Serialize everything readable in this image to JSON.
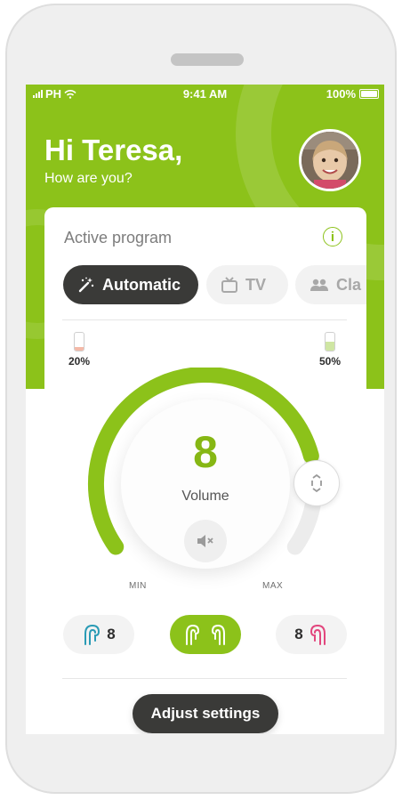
{
  "status_bar": {
    "carrier": "PH",
    "time": "9:41 AM",
    "battery": "100%"
  },
  "header": {
    "greeting": "Hi Teresa,",
    "subtitle": "How are you?"
  },
  "program_card": {
    "title": "Active program",
    "info_label": "i",
    "programs": [
      {
        "label": "Automatic",
        "icon": "magic-wand-icon",
        "active": true
      },
      {
        "label": "TV",
        "icon": "tv-icon",
        "active": false
      },
      {
        "label": "Cla",
        "icon": "group-icon",
        "active": false
      }
    ]
  },
  "hearing_aid_batteries": {
    "left": {
      "label": "20%",
      "level": 0.2,
      "color": "#f4b9a8"
    },
    "right": {
      "label": "50%",
      "level": 0.5,
      "color": "#cfe6a3"
    }
  },
  "volume": {
    "value": "8",
    "label": "Volume",
    "level": 0.8,
    "min_label": "MIN",
    "max_label": "MAX"
  },
  "sides": {
    "left_value": "8",
    "right_value": "8"
  },
  "adjust_button": {
    "label": "Adjust settings"
  },
  "colors": {
    "accent": "#8cc21a",
    "dark": "#3a3a38",
    "left_ear": "#2a9bb5",
    "right_ear": "#e2467d"
  }
}
